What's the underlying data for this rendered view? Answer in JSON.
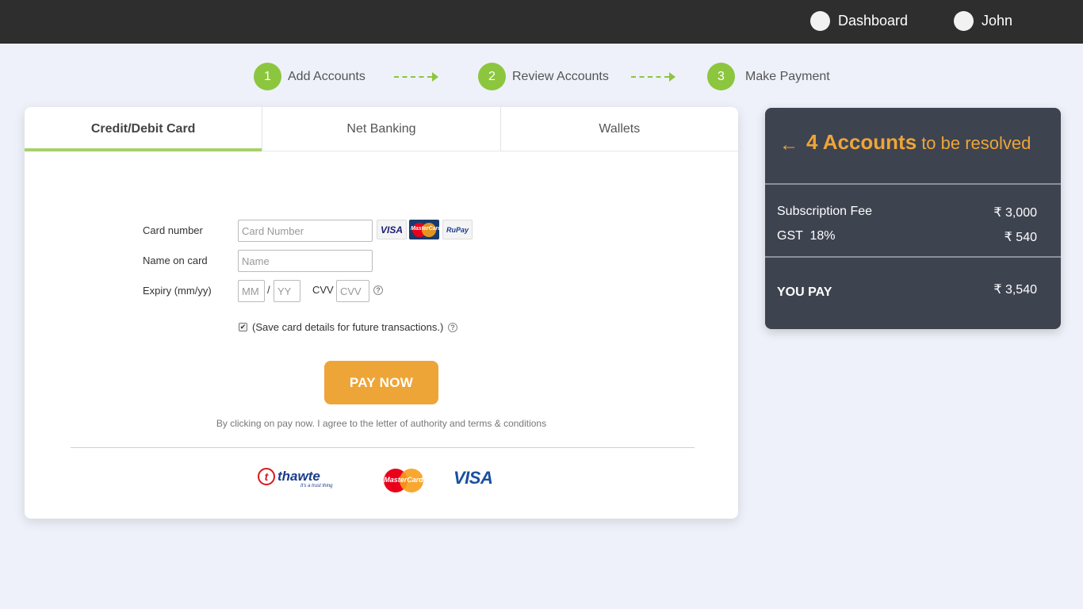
{
  "nav": {
    "dashboard": "Dashboard",
    "user": "John"
  },
  "steps": [
    {
      "num": "1",
      "label": "Add Accounts"
    },
    {
      "num": "2",
      "label": "Review Accounts"
    },
    {
      "num": "3",
      "label": "Make Payment"
    }
  ],
  "tabs": [
    {
      "label": "Credit/Debit Card",
      "active": true
    },
    {
      "label": "Net Banking",
      "active": false
    },
    {
      "label": "Wallets",
      "active": false
    }
  ],
  "form": {
    "card_number_label": "Card number",
    "card_number_placeholder": "Card Number",
    "name_label": "Name on card",
    "name_placeholder": "Name",
    "expiry_label": "Expiry (mm/yy)",
    "mm_placeholder": "MM",
    "separator": "/",
    "yy_placeholder": "YY",
    "cvv_label": "CVV",
    "cvv_placeholder": "CVV",
    "help_glyph": "?",
    "save_card_label": "(Save card details for future transactions.)",
    "save_card_checked": true
  },
  "brands": {
    "visa": "VISA",
    "mastercard": "MasterCard",
    "rupay": "RuPay"
  },
  "pay_button": "PAY NOW",
  "terms": "By clicking on pay now. I agree to the letter of authority and terms & conditions",
  "trust_logos": {
    "thawte": "thawte",
    "thawte_tag": "It's a trust thing",
    "mastercard": "MasterCard",
    "visa": "VISA"
  },
  "summary": {
    "back_arrow": "←",
    "count": "4 Accounts",
    "heading_rest": "to be resolved",
    "rows": [
      {
        "label": "Subscription Fee",
        "amount": "₹ 3,000"
      },
      {
        "label": "GST  18%",
        "amount": "₹ 540"
      }
    ],
    "total_label": "YOU PAY",
    "total_amount": "₹ 3,540"
  },
  "colors": {
    "accent_green": "#8cc63f",
    "accent_orange": "#eea538",
    "topbar": "#2e2e2e",
    "summary_bg": "#3e4350"
  }
}
